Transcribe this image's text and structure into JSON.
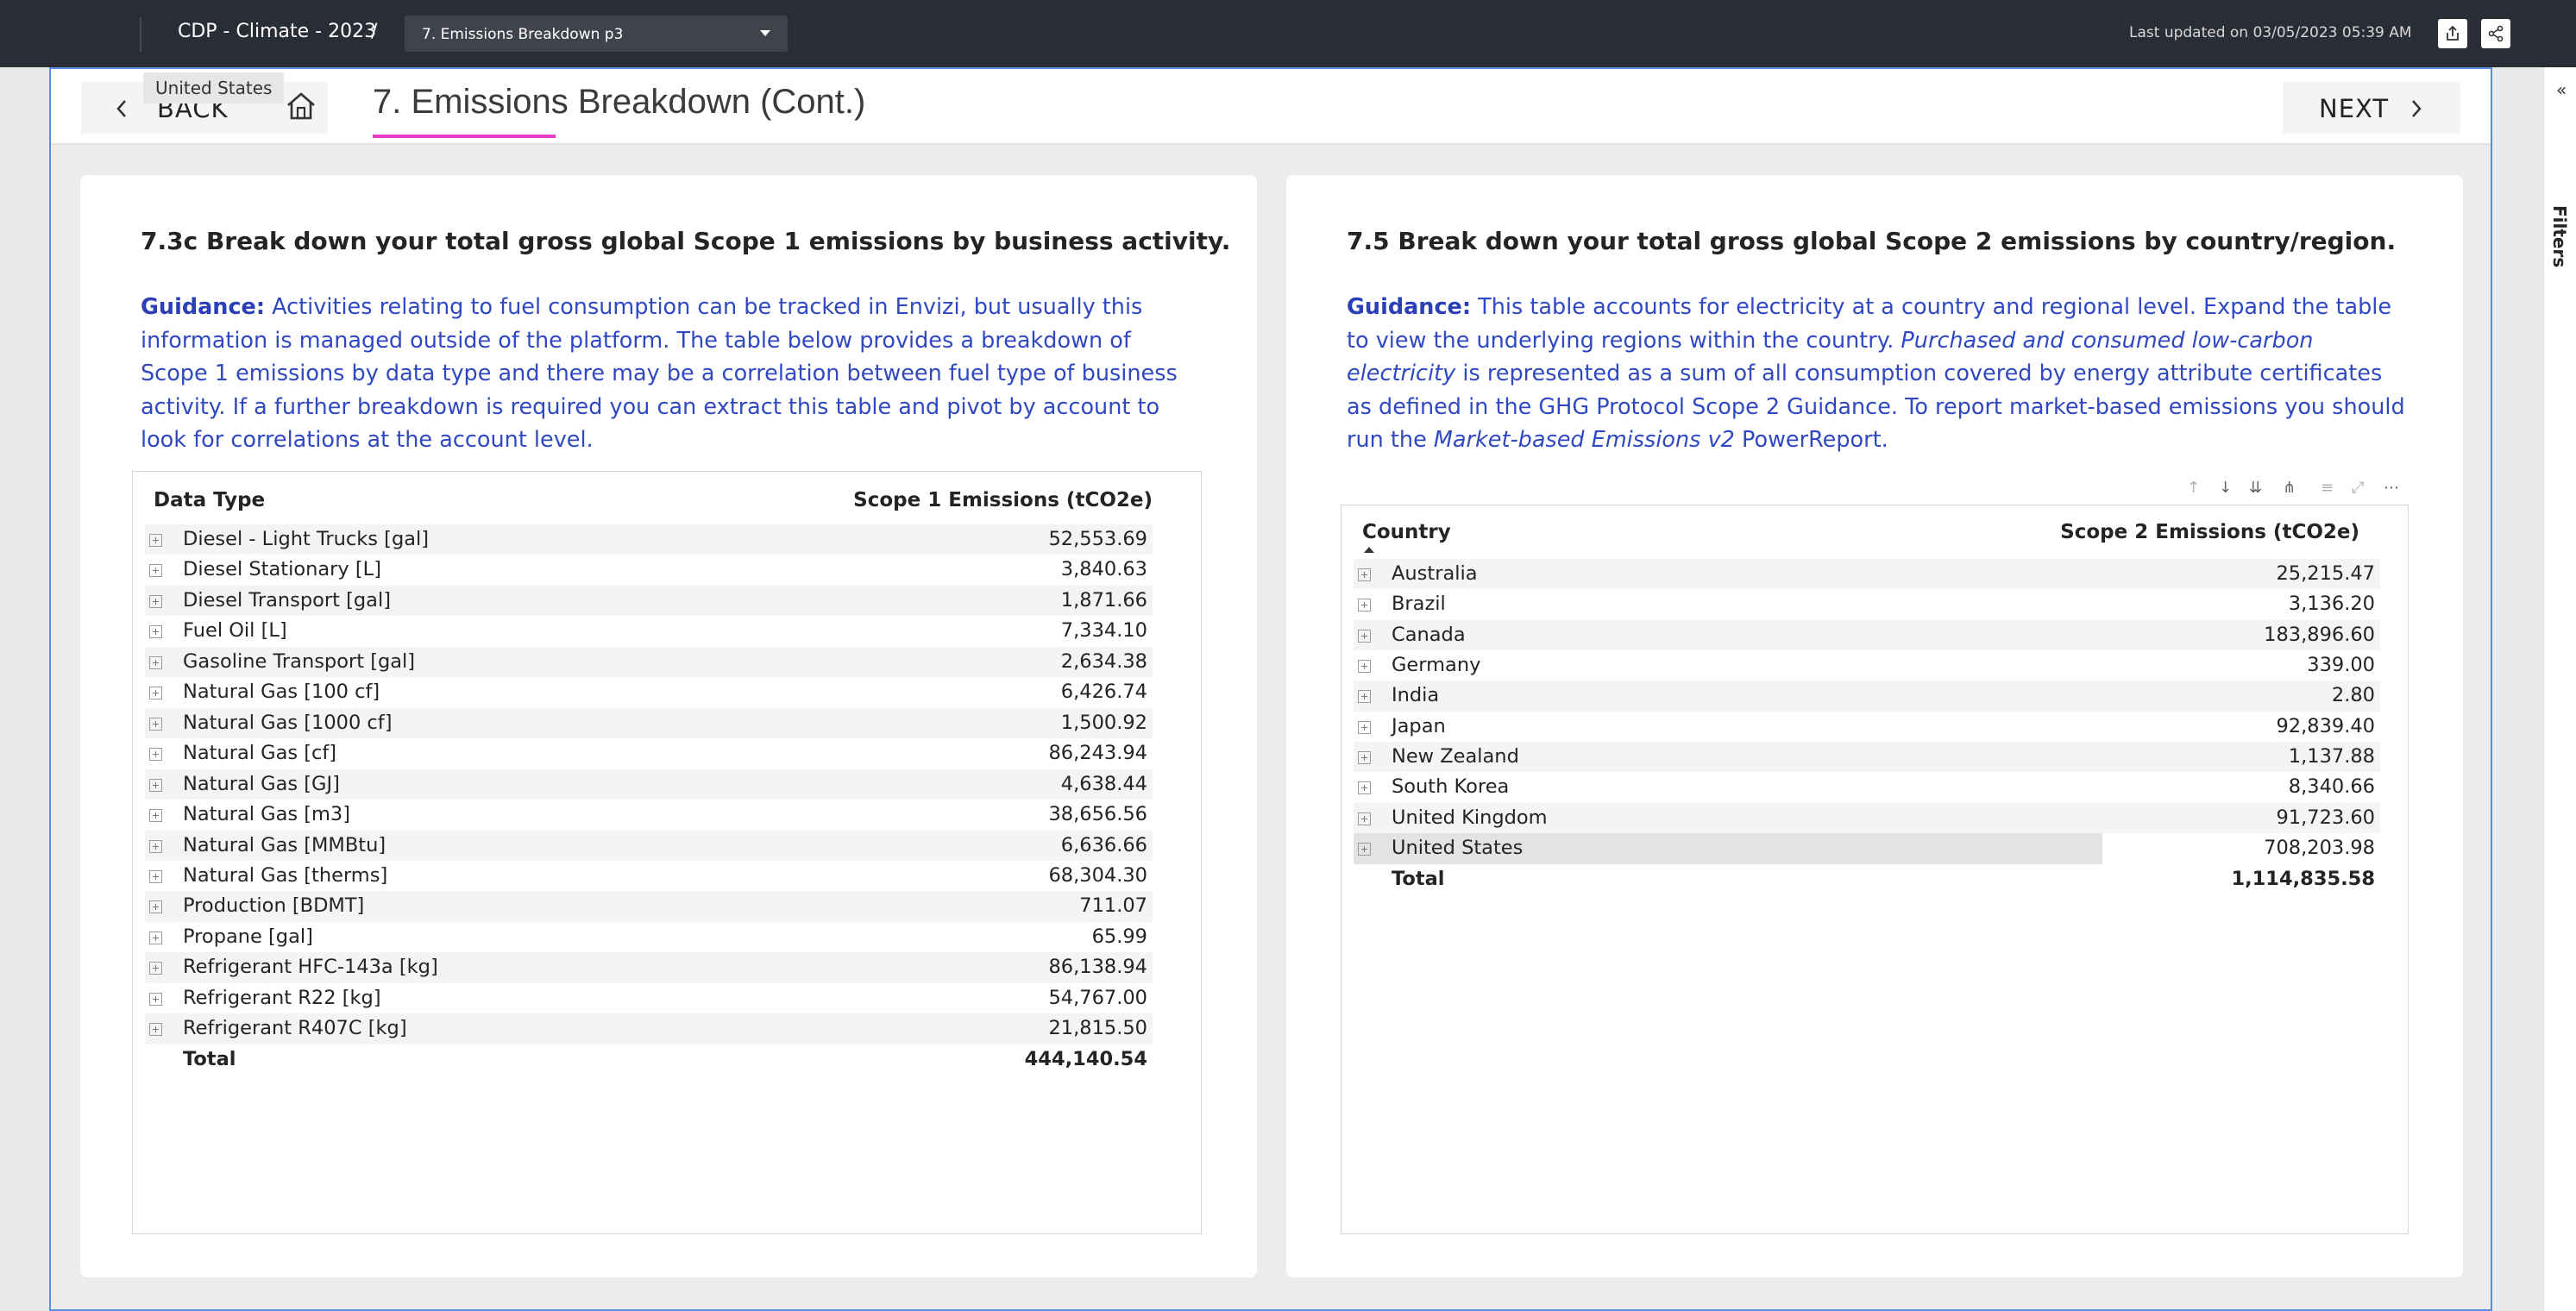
{
  "topbar": {
    "report_title": "CDP - Climate - 2023",
    "breadcrumb_separator": "/",
    "page_selector": "7. Emissions Breakdown p3",
    "last_updated": "Last updated on 03/05/2023 05:39 AM"
  },
  "header": {
    "back_label": "BACK",
    "next_label": "NEXT",
    "page_title": "7. Emissions Breakdown (Cont.)",
    "tooltip": "United States"
  },
  "left_card": {
    "heading": "7.3c Break down your total gross global Scope 1 emissions by business activity.",
    "guidance_label": "Guidance:",
    "guidance_text": " Activities relating to fuel consumption can be tracked in Envizi, but usually this information is managed outside of the platform. The table below provides a breakdown of Scope 1 emissions by data type and there may be a correlation between fuel type of business activity. If a further breakdown is required you can extract this table and pivot by account to look for correlations at the account level.",
    "table": {
      "col1": "Data Type",
      "col2": "Scope 1 Emissions (tCO2e)",
      "rows": [
        {
          "name": "Diesel - Light Trucks [gal]",
          "value": "52,553.69"
        },
        {
          "name": "Diesel Stationary [L]",
          "value": "3,840.63"
        },
        {
          "name": "Diesel Transport [gal]",
          "value": "1,871.66"
        },
        {
          "name": "Fuel Oil [L]",
          "value": "7,334.10"
        },
        {
          "name": "Gasoline Transport [gal]",
          "value": "2,634.38"
        },
        {
          "name": "Natural Gas [100 cf]",
          "value": "6,426.74"
        },
        {
          "name": "Natural Gas [1000 cf]",
          "value": "1,500.92"
        },
        {
          "name": "Natural Gas [cf]",
          "value": "86,243.94"
        },
        {
          "name": "Natural Gas [GJ]",
          "value": "4,638.44"
        },
        {
          "name": "Natural Gas [m3]",
          "value": "38,656.56"
        },
        {
          "name": "Natural Gas [MMBtu]",
          "value": "6,636.66"
        },
        {
          "name": "Natural Gas [therms]",
          "value": "68,304.30"
        },
        {
          "name": "Production [BDMT]",
          "value": "711.07"
        },
        {
          "name": "Propane [gal]",
          "value": "65.99"
        },
        {
          "name": "Refrigerant HFC-143a [kg]",
          "value": "86,138.94"
        },
        {
          "name": "Refrigerant R22 [kg]",
          "value": "54,767.00"
        },
        {
          "name": "Refrigerant R407C [kg]",
          "value": "21,815.50"
        }
      ],
      "total_label": "Total",
      "total_value": "444,140.54"
    }
  },
  "right_card": {
    "heading": "7.5 Break down your total gross global Scope 2 emissions by country/region.",
    "guidance_label": "Guidance:",
    "guidance_part1": " This table accounts for electricity at a country and regional level. Expand the table to view the underlying regions within the country. ",
    "guidance_italic1": "Purchased and consumed low-carbon electricity",
    "guidance_part2": " is represented as a sum of all consumption covered by energy attribute certificates as defined in the GHG Protocol Scope 2 Guidance. To report market-based emissions you should run the ",
    "guidance_italic2": "Market-based Emissions v2",
    "guidance_part3": " PowerReport.",
    "table": {
      "col1": "Country",
      "col2": "Scope 2 Emissions (tCO2e)",
      "rows": [
        {
          "name": "Australia",
          "value": "25,215.47"
        },
        {
          "name": "Brazil",
          "value": "3,136.20"
        },
        {
          "name": "Canada",
          "value": "183,896.60"
        },
        {
          "name": "Germany",
          "value": "339.00"
        },
        {
          "name": "India",
          "value": "2.80"
        },
        {
          "name": "Japan",
          "value": "92,839.40"
        },
        {
          "name": "New Zealand",
          "value": "1,137.88"
        },
        {
          "name": "South Korea",
          "value": "8,340.66"
        },
        {
          "name": "United Kingdom",
          "value": "91,723.60"
        },
        {
          "name": "United States",
          "value": "708,203.98"
        }
      ],
      "total_label": "Total",
      "total_value": "1,114,835.58"
    }
  },
  "visual_header_icons": [
    "arrow-up-icon",
    "arrow-down-icon",
    "double-arrow-down-icon",
    "expand-hierarchy-icon",
    "filter-icon",
    "focus-mode-icon",
    "more-options-icon"
  ],
  "filters_pane": {
    "label": "Filters",
    "collapse_glyph": "«"
  },
  "colors": {
    "topbar": "#2b2d36",
    "guidance": "#3049c2",
    "title_underline": "#e63ec8",
    "canvas_border": "#5b8de6"
  }
}
